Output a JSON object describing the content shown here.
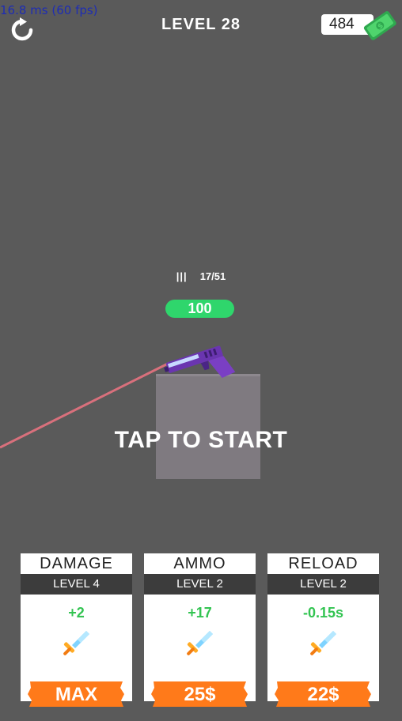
{
  "hud": {
    "fps_text": "16.8 ms (60 fps)",
    "level_title": "LEVEL 28",
    "cash": "484",
    "restart_icon": "restart-icon",
    "cash_icon": "cash-icon"
  },
  "gun": {
    "ammo_icon": "|||",
    "ammo_count": "17/51",
    "target_hp": "100"
  },
  "prompt": "TAP TO START",
  "upgrades": [
    {
      "title": "DAMAGE",
      "level": "LEVEL 4",
      "bonus": "+2",
      "price": "MAX"
    },
    {
      "title": "AMMO",
      "level": "LEVEL 2",
      "bonus": "+17",
      "price": "25$"
    },
    {
      "title": "RELOAD",
      "level": "LEVEL 2",
      "bonus": "-0.15s",
      "price": "22$"
    }
  ],
  "colors": {
    "background": "#5a5a5a",
    "hp_bar": "#2fd66c",
    "buy_button": "#ff7a1a",
    "bonus_text": "#33c452",
    "laser": "#d9707c",
    "gun": "#7a3fc4"
  }
}
